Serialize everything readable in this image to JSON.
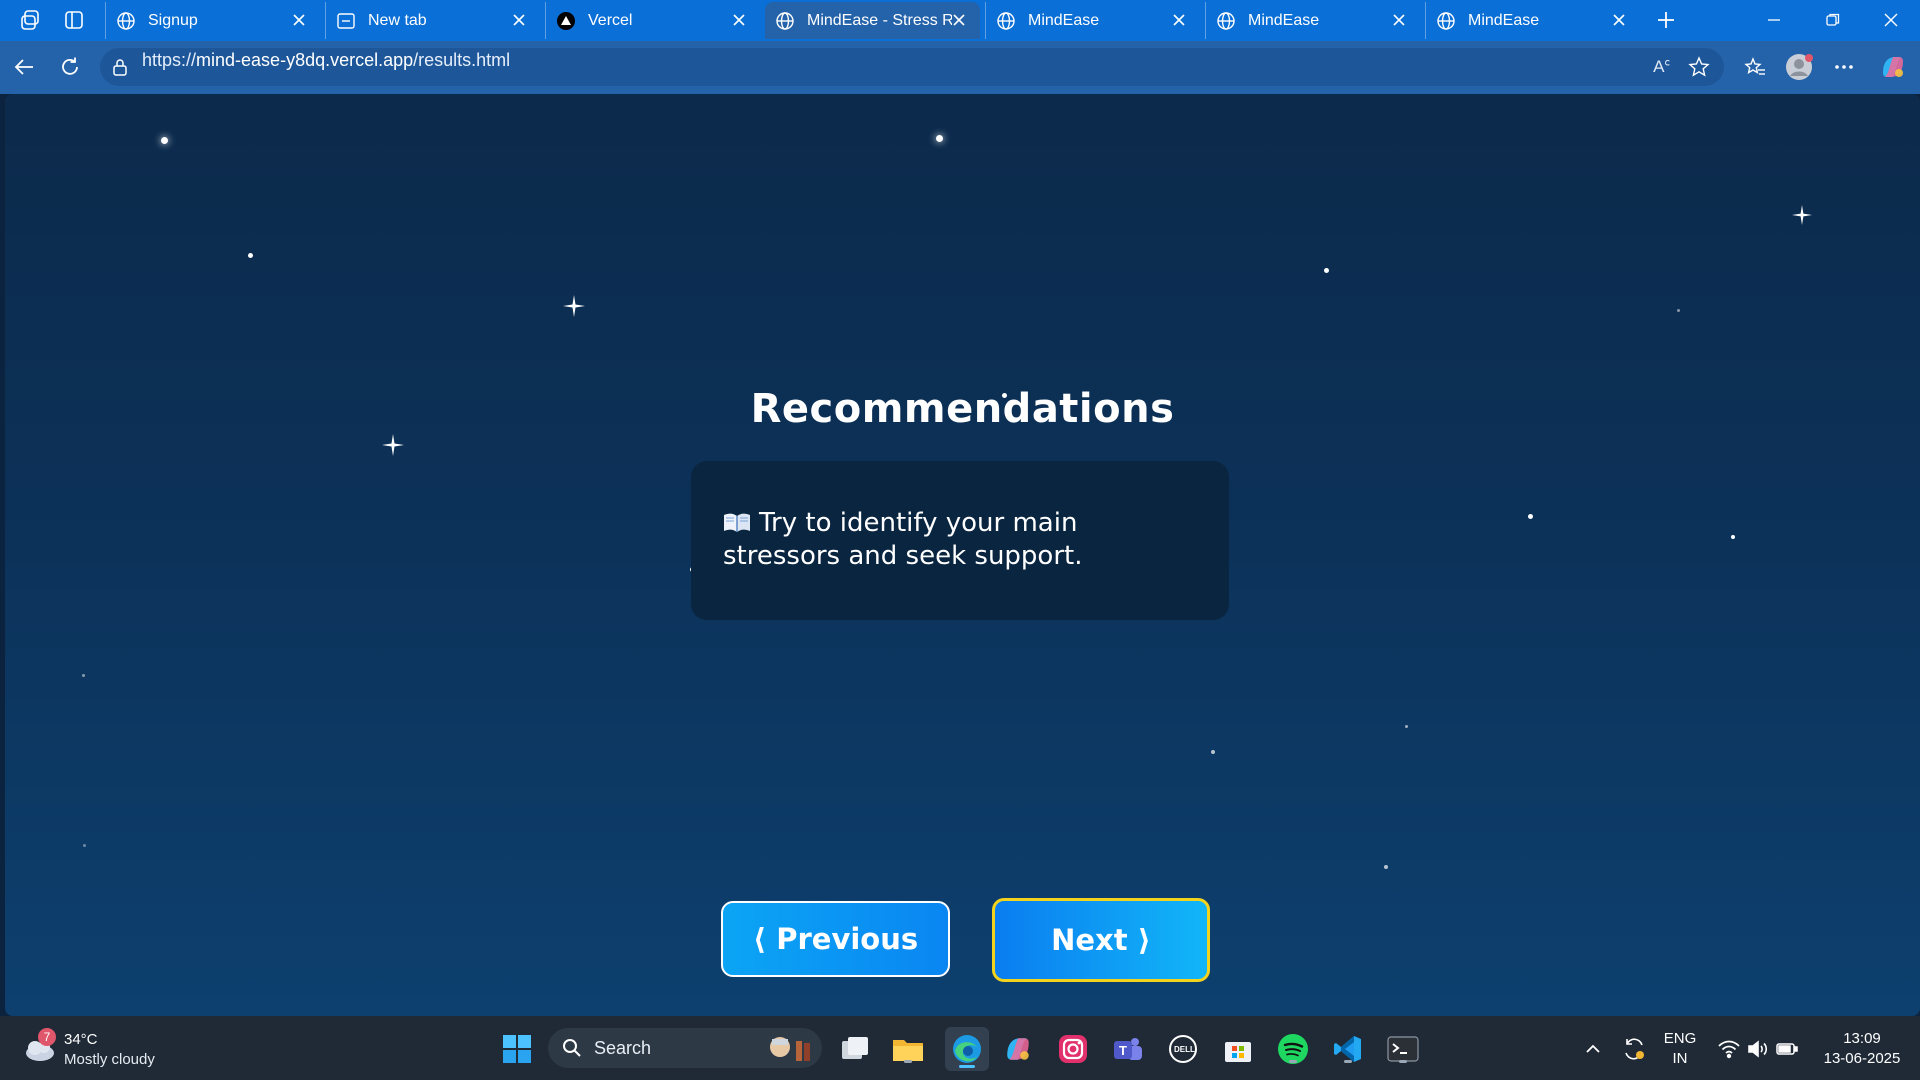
{
  "browser": {
    "tabs": [
      {
        "title": "Signup",
        "favicon": "globe-icon",
        "active": false
      },
      {
        "title": "New tab",
        "favicon": "newtab-icon",
        "active": false
      },
      {
        "title": "Vercel",
        "favicon": "vercel-icon",
        "active": false
      },
      {
        "title": "MindEase - Stress Res",
        "favicon": "globe-icon",
        "active": true
      },
      {
        "title": "MindEase",
        "favicon": "globe-icon",
        "active": false
      },
      {
        "title": "MindEase",
        "favicon": "globe-icon",
        "active": false
      },
      {
        "title": "MindEase",
        "favicon": "globe-icon",
        "active": false
      }
    ],
    "url": {
      "scheme": "https://",
      "domain": "mind-ease-y8dq.vercel.app",
      "path": "/results.html"
    }
  },
  "page": {
    "heading": "Recommendations",
    "recommendation": {
      "icon": "book-icon",
      "text": "Try to identify your main stressors and seek support."
    },
    "buttons": {
      "previous": "⟨ Previous",
      "next": "Next ⟩"
    }
  },
  "taskbar": {
    "weather": {
      "badge": "7",
      "temperature": "34°C",
      "condition": "Mostly cloudy"
    },
    "search_label": "Search",
    "language": {
      "line1": "ENG",
      "line2": "IN"
    },
    "clock": {
      "time": "13:09",
      "date": "13-06-2025"
    }
  },
  "colors": {
    "tabstrip": "#0a6fd6",
    "toolbar": "#2463aa",
    "page_background_top": "#0c2a4b",
    "card": "#0a2540",
    "next_border": "#f4d31c"
  }
}
